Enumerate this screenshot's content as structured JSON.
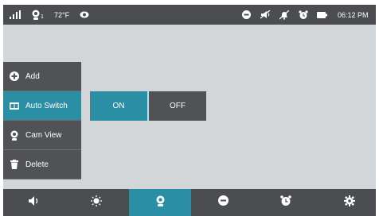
{
  "status": {
    "temperature": "72°F",
    "time": "06:12 PM"
  },
  "menu": {
    "items": [
      {
        "label": "Add",
        "icon": "plus-circle-icon",
        "active": false
      },
      {
        "label": "Auto Switch",
        "icon": "auto-switch-icon",
        "active": true
      },
      {
        "label": "Cam View",
        "icon": "camera-icon",
        "active": false
      },
      {
        "label": "Delete",
        "icon": "trash-icon",
        "active": false
      }
    ]
  },
  "auto_switch": {
    "on_label": "ON",
    "off_label": "OFF",
    "selected": "ON"
  },
  "bottom_bar": {
    "items": [
      {
        "icon": "volume-icon",
        "active": false
      },
      {
        "icon": "brightness-icon",
        "active": false
      },
      {
        "icon": "camera-icon",
        "active": true
      },
      {
        "icon": "vox-icon",
        "active": false
      },
      {
        "icon": "alarm-clock-icon",
        "active": false
      },
      {
        "icon": "settings-gear-icon",
        "active": false
      }
    ]
  },
  "colors": {
    "accent": "#2a8fa4",
    "bar": "#4b4d50",
    "panel": "#505255",
    "background": "#d3d6d9"
  }
}
